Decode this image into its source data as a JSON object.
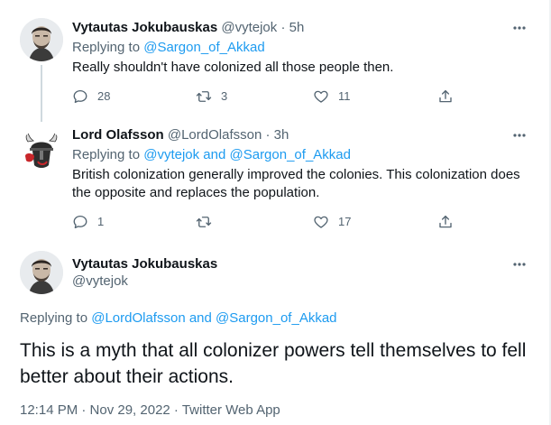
{
  "tweets": [
    {
      "author_name": "Vytautas Jokubauskas",
      "handle": "@vytejok",
      "separator": "·",
      "time": "5h",
      "replying_prefix": "Replying to",
      "replying_to": "@Sargon_of_Akkad",
      "text": "Really shouldn't have colonized all those people then.",
      "replies": "28",
      "retweets": "3",
      "likes": "11"
    },
    {
      "author_name": "Lord Olafsson",
      "handle": "@LordOlafsson",
      "separator": "·",
      "time": "3h",
      "replying_prefix": "Replying to",
      "replying_to": "@vytejok and @Sargon_of_Akkad",
      "text": "British colonization generally improved the colonies. This colonization does the opposite and replaces the population.",
      "replies": "1",
      "retweets": "",
      "likes": "17"
    }
  ],
  "main_tweet": {
    "author_name": "Vytautas Jokubauskas",
    "handle": "@vytejok",
    "replying_prefix": "Replying to",
    "replying_to": "@LordOlafsson and @Sargon_of_Akkad",
    "text": "This is a myth that all colonizer powers tell themselves to fell better about their actions.",
    "timestamp": "12:14 PM · Nov 29, 2022 · Twitter Web App"
  },
  "icons": {
    "reply": "reply-icon",
    "retweet": "retweet-icon",
    "like": "heart-icon",
    "share": "share-icon",
    "more": "more-icon"
  },
  "colors": {
    "link": "#1d9bf0",
    "secondary_text": "#536471",
    "primary_text": "#0f1419",
    "thread_line": "#cfd9de"
  }
}
